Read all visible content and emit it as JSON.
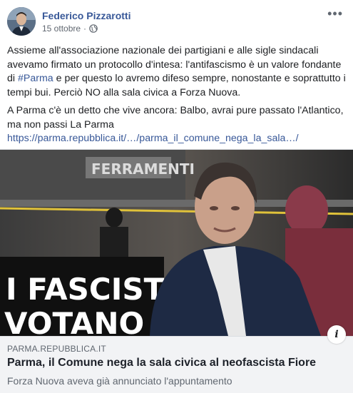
{
  "post": {
    "author": "Federico Pizzarotti",
    "date": "15 ottobre",
    "separator": "·",
    "privacy_icon": "globe-icon",
    "more_icon": "ellipsis-icon",
    "more_label": "•••",
    "paragraph1": {
      "before": "Assieme all'associazione nazionale dei partigiani e alle sigle sindacali avevamo firmato un protocollo d'intesa: l'antifascismo è un valore fondante di ",
      "hashtag": "#Parma",
      "after": " e per questo lo avremo difeso sempre, nonostante e soprattutto i tempi bui. Perciò NO alla sala civica a Forza Nuova."
    },
    "paragraph2": {
      "before": "A Parma c'è un detto che vive ancora: Balbo, avrai pure passato l'Atlantico, ma non passi La Parma ",
      "link": "https://parma.repubblica.it/…/parma_il_comune_nega_la_sala…/"
    }
  },
  "preview": {
    "image_sign": "FERRAMENTI",
    "banner_line1": "I FASCIST",
    "banner_line2": "VOTANO",
    "domain": "PARMA.REPUBBLICA.IT",
    "title": "Parma, il Comune nega la sala civica al neofascista Fiore",
    "description": "Forza Nuova aveva già annunciato l'appuntamento",
    "info_label": "i"
  },
  "colors": {
    "link": "#385898",
    "text": "#1c1e21",
    "secondary": "#606770",
    "linkbox_bg": "#f2f3f5"
  }
}
